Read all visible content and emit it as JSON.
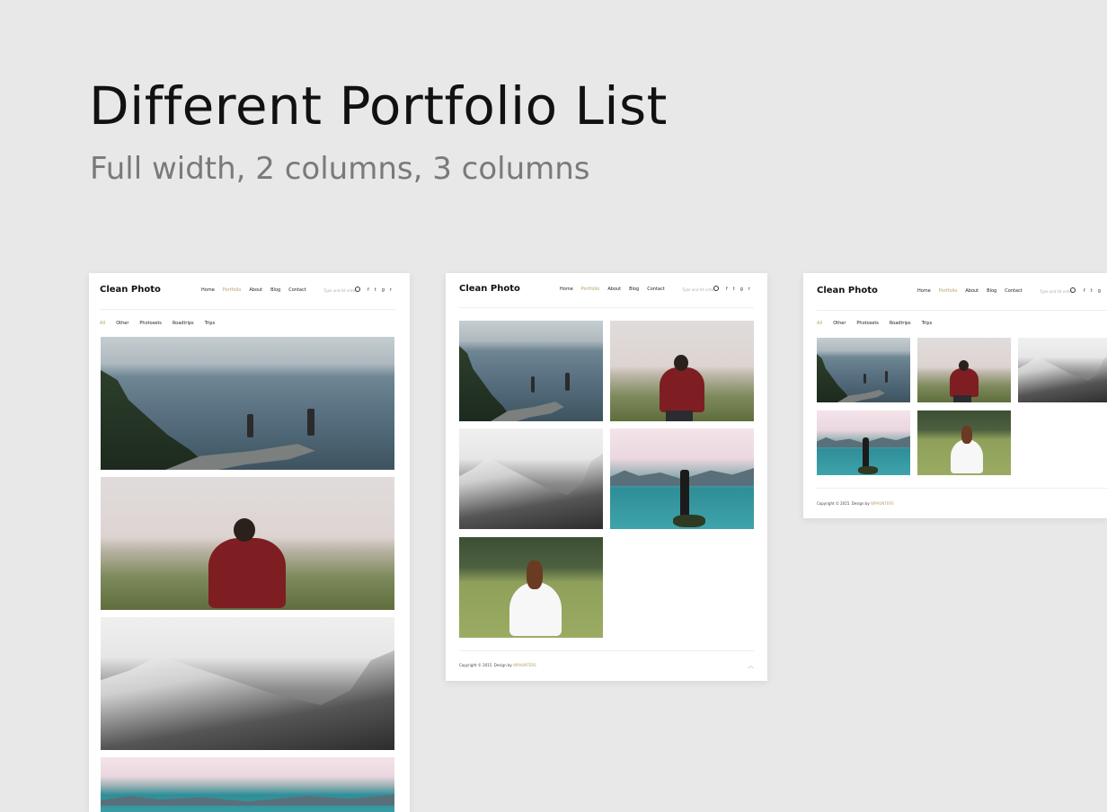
{
  "hero": {
    "title": "Different Portfolio List",
    "subtitle": "Full width, 2 columns, 3 columns"
  },
  "site": {
    "logo": "Clean Photo",
    "nav": [
      "Home",
      "Portfolio",
      "About",
      "Blog",
      "Contact"
    ],
    "active_nav": "Portfolio",
    "search_placeholder": "Type and hit enter",
    "social_icons": [
      "facebook-icon",
      "twitter-icon",
      "google-plus-icon",
      "rss-icon"
    ],
    "social_glyphs": [
      "f",
      "t",
      "g",
      "r"
    ],
    "filters": [
      "All",
      "Other",
      "Photosets",
      "Roadtrips",
      "Trips"
    ],
    "active_filter": "All",
    "footer_copyright": "Copyright © 2015. Design by",
    "footer_brand": "WPHUNTERS",
    "accent_color": "#b9a26b"
  },
  "photos": [
    "mountain-hikers",
    "man-red-jacket-meadow",
    "snowy-mountains",
    "lake-pink-sky",
    "woman-white-dress"
  ]
}
